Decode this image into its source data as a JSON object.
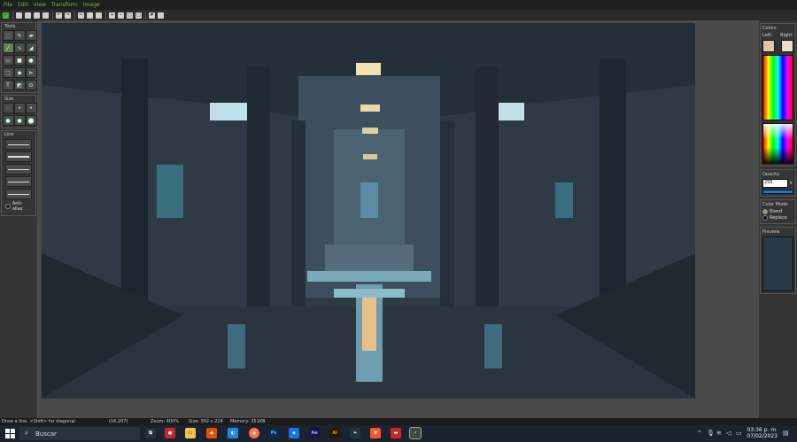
{
  "menu": [
    "File",
    "Edit",
    "View",
    "Transform",
    "Image"
  ],
  "left_panel": {
    "tools_title": "Tools",
    "size_title": "Size",
    "line_title": "Line",
    "antialias_label": "Anti-alias"
  },
  "right_panel": {
    "colors_title": "Colors",
    "left_label": "Left:",
    "right_label": "Right:",
    "left_color": "#e2c2a8",
    "right_color": "#f0dcc6",
    "opacity_title": "Opacity",
    "opacity_value": "255",
    "color_mode_title": "Color Mode",
    "blend_label": "Blend",
    "replace_label": "Replace",
    "preview_title": "Preview"
  },
  "status": {
    "hint": "Draw a line. <Shift> for diagonal",
    "coords": "(16,207)",
    "zoom": "Zoom: 400%",
    "size": "Size: 392 x 224",
    "memory": "Memory: 351KB"
  },
  "taskbar": {
    "search_label": "Buscar",
    "time": "03:36 p. m.",
    "date": "07/02/2023",
    "apps": [
      "task-view",
      "record",
      "file-explorer",
      "brave-lion",
      "paint-net",
      "firefox",
      "photoshop",
      "dropbox",
      "after-effects",
      "illustrator",
      "mastodon",
      "brave",
      "game",
      "pixel-editor"
    ]
  },
  "colors": {
    "accent_green": "#7cb342",
    "canvas_bg": "#2b3640"
  }
}
